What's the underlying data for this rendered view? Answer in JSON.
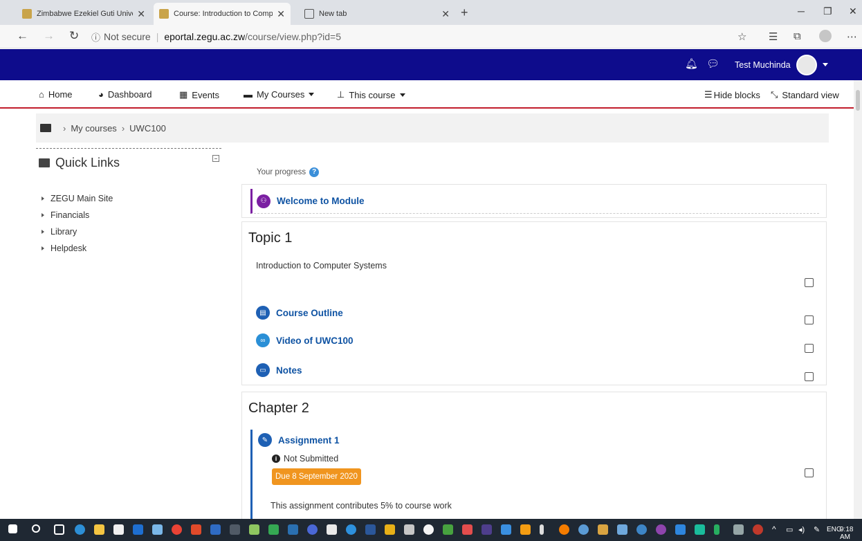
{
  "browser": {
    "tabs": [
      {
        "title": "Zimbabwe Ezekiel Guti University",
        "active": false
      },
      {
        "title": "Course: Introduction to Computer Systems",
        "active": true
      },
      {
        "title": "New tab",
        "active": false
      }
    ],
    "address": {
      "security": "Not secure",
      "host": "eportal.zegu.ac.zw",
      "path": "/course/view.php?id=5"
    }
  },
  "header": {
    "username": "Test Muchinda",
    "brand_color": "#0e0c8c",
    "accent_color": "#c21d2c"
  },
  "nav": {
    "home": "Home",
    "dashboard": "Dashboard",
    "events": "Events",
    "my_courses": "My Courses",
    "this_course": "This course",
    "hide_blocks": "Hide blocks",
    "standard_view": "Standard view"
  },
  "breadcrumb": {
    "items": [
      "My courses",
      "UWC100"
    ]
  },
  "quick_links": {
    "title": "Quick Links",
    "items": [
      "ZEGU Main Site",
      "Financials",
      "Library",
      "Helpdesk"
    ]
  },
  "course": {
    "progress_label": "Your progress",
    "welcome": "Welcome to Module",
    "topic1": {
      "title": "Topic 1",
      "summary": "Introduction to Computer Systems",
      "activities": [
        "Course Outline",
        "Video of UWC100",
        "Notes"
      ]
    },
    "chapter2": {
      "title": "Chapter 2",
      "assignment": "Assignment 1",
      "status": "Not Submitted",
      "due": "Due 8 September 2020",
      "note": "This assignment contributes 5% to course work"
    }
  },
  "taskbar": {
    "lang": "ENG",
    "time": "9:18 AM"
  }
}
